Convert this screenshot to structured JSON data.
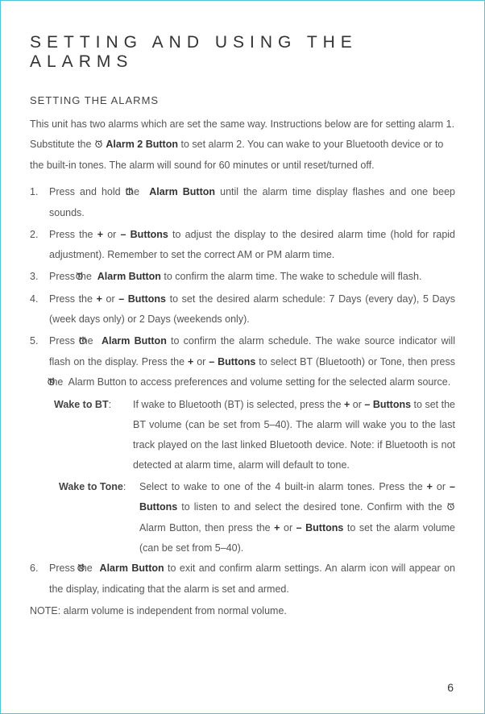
{
  "heading_main": "SETTING AND USING THE ALARMS",
  "heading_section": "SETTING THE ALARMS",
  "intro_text_1": "This unit has two alarms which are set the same way. Instructions below are for setting alarm 1. Substitute the ",
  "intro_alarm2_label": "Alarm 2 Button",
  "intro_text_2": " to set alarm 2.  You can wake to your Bluetooth device or to the built-in tones. The alarm will sound for 60 minutes or until reset/turned off.",
  "steps": {
    "s1_num": "1.",
    "s1_a": "Press and hold the ",
    "s1_b": "Alarm Button",
    "s1_c": " until the alarm time display flashes and one beep sounds.",
    "s2_num": "2.",
    "s2_a": "Press the ",
    "s2_plus": "+",
    "s2_or": " or ",
    "s2_minus": "– Buttons",
    "s2_c": " to adjust the display to the desired alarm time (hold for rapid adjustment). Remember to set the correct AM or PM alarm time.",
    "s3_num": "3.",
    "s3_a": "Press the ",
    "s3_b": "Alarm Button",
    "s3_c": " to confirm the alarm time. The wake to schedule will flash.",
    "s4_num": "4.",
    "s4_a": "Press the  ",
    "s4_plus": "+",
    "s4_or": " or ",
    "s4_minus": "– Buttons",
    "s4_c": " to set the desired alarm schedule:  7 Days (every day), 5 Days (week days only) or 2 Days (weekends only).",
    "s5_num": "5.",
    "s5_a": "Press the ",
    "s5_b": "Alarm Button",
    "s5_c": " to confirm the alarm schedule. The wake source indicator will flash on the display. Press the ",
    "s5_plus": "+",
    "s5_or": " or ",
    "s5_minus": "– Buttons",
    "s5_d": " to select BT (Bluetooth) or Tone, then press the ",
    "s5_e": " Alarm Button to access preferences and volume setting for the selected alarm source.",
    "wake_bt_label": "Wake to BT",
    "wake_bt_colon": ":   ",
    "wake_bt_a": "If wake to Bluetooth (BT) is selected, press the ",
    "wake_bt_plus": "+",
    "wake_bt_or": " or ",
    "wake_bt_minus": "– Buttons",
    "wake_bt_b": " to set the BT volume (can be set from 5–40). The alarm will wake you to the last track played on the last linked Bluetooth device. Note: if Bluetooth is not detected at alarm time, alarm will default to tone.",
    "wake_tone_label": "Wake to Tone",
    "wake_tone_colon": ":  ",
    "wake_tone_a": "Select to wake to one of the 4 built-in alarm tones. Press the ",
    "wake_tone_plus": "+",
    "wake_tone_or": " or ",
    "wake_tone_minus": "– Buttons",
    "wake_tone_b": " to listen to and select the desired tone. Confirm with the ",
    "wake_tone_c": " Alarm Button, then press the ",
    "wake_tone_plus2": "+",
    "wake_tone_or2": " or ",
    "wake_tone_minus2": "– Buttons",
    "wake_tone_d": " to set the alarm volume (can be set from 5–40).",
    "s6_num": "6.",
    "s6_a": "Press the ",
    "s6_b": "Alarm Button",
    "s6_c": " to exit and confirm alarm settings. An alarm icon will appear on the display, indicating that the alarm is set and armed."
  },
  "note_text": "NOTE: alarm volume is independent from normal volume.",
  "page_number": "6"
}
